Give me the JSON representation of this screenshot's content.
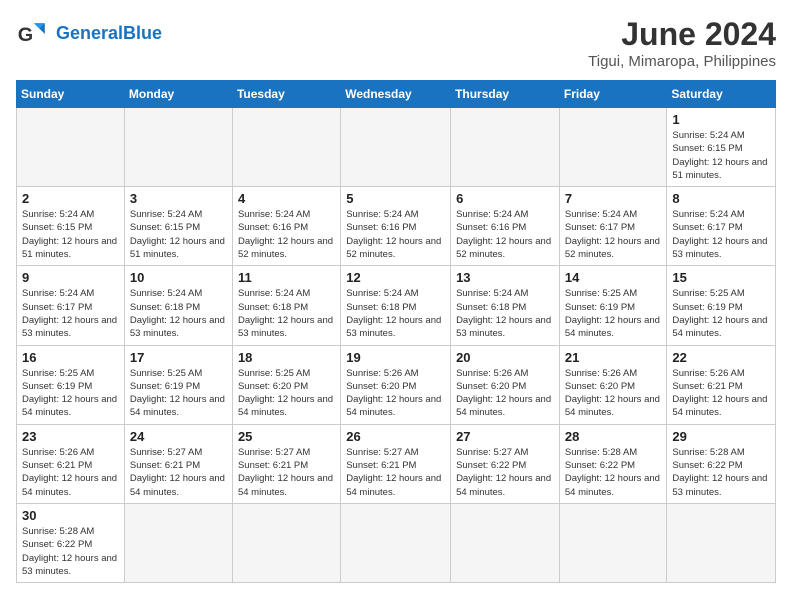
{
  "header": {
    "logo_general": "General",
    "logo_blue": "Blue",
    "month_title": "June 2024",
    "location": "Tigui, Mimaropa, Philippines"
  },
  "days_of_week": [
    "Sunday",
    "Monday",
    "Tuesday",
    "Wednesday",
    "Thursday",
    "Friday",
    "Saturday"
  ],
  "weeks": [
    [
      {
        "day": "",
        "info": ""
      },
      {
        "day": "",
        "info": ""
      },
      {
        "day": "",
        "info": ""
      },
      {
        "day": "",
        "info": ""
      },
      {
        "day": "",
        "info": ""
      },
      {
        "day": "",
        "info": ""
      },
      {
        "day": "1",
        "info": "Sunrise: 5:24 AM\nSunset: 6:15 PM\nDaylight: 12 hours and 51 minutes."
      }
    ],
    [
      {
        "day": "2",
        "info": "Sunrise: 5:24 AM\nSunset: 6:15 PM\nDaylight: 12 hours and 51 minutes."
      },
      {
        "day": "3",
        "info": "Sunrise: 5:24 AM\nSunset: 6:15 PM\nDaylight: 12 hours and 51 minutes."
      },
      {
        "day": "4",
        "info": "Sunrise: 5:24 AM\nSunset: 6:16 PM\nDaylight: 12 hours and 52 minutes."
      },
      {
        "day": "5",
        "info": "Sunrise: 5:24 AM\nSunset: 6:16 PM\nDaylight: 12 hours and 52 minutes."
      },
      {
        "day": "6",
        "info": "Sunrise: 5:24 AM\nSunset: 6:16 PM\nDaylight: 12 hours and 52 minutes."
      },
      {
        "day": "7",
        "info": "Sunrise: 5:24 AM\nSunset: 6:17 PM\nDaylight: 12 hours and 52 minutes."
      },
      {
        "day": "8",
        "info": "Sunrise: 5:24 AM\nSunset: 6:17 PM\nDaylight: 12 hours and 53 minutes."
      }
    ],
    [
      {
        "day": "9",
        "info": "Sunrise: 5:24 AM\nSunset: 6:17 PM\nDaylight: 12 hours and 53 minutes."
      },
      {
        "day": "10",
        "info": "Sunrise: 5:24 AM\nSunset: 6:18 PM\nDaylight: 12 hours and 53 minutes."
      },
      {
        "day": "11",
        "info": "Sunrise: 5:24 AM\nSunset: 6:18 PM\nDaylight: 12 hours and 53 minutes."
      },
      {
        "day": "12",
        "info": "Sunrise: 5:24 AM\nSunset: 6:18 PM\nDaylight: 12 hours and 53 minutes."
      },
      {
        "day": "13",
        "info": "Sunrise: 5:24 AM\nSunset: 6:18 PM\nDaylight: 12 hours and 53 minutes."
      },
      {
        "day": "14",
        "info": "Sunrise: 5:25 AM\nSunset: 6:19 PM\nDaylight: 12 hours and 54 minutes."
      },
      {
        "day": "15",
        "info": "Sunrise: 5:25 AM\nSunset: 6:19 PM\nDaylight: 12 hours and 54 minutes."
      }
    ],
    [
      {
        "day": "16",
        "info": "Sunrise: 5:25 AM\nSunset: 6:19 PM\nDaylight: 12 hours and 54 minutes."
      },
      {
        "day": "17",
        "info": "Sunrise: 5:25 AM\nSunset: 6:19 PM\nDaylight: 12 hours and 54 minutes."
      },
      {
        "day": "18",
        "info": "Sunrise: 5:25 AM\nSunset: 6:20 PM\nDaylight: 12 hours and 54 minutes."
      },
      {
        "day": "19",
        "info": "Sunrise: 5:26 AM\nSunset: 6:20 PM\nDaylight: 12 hours and 54 minutes."
      },
      {
        "day": "20",
        "info": "Sunrise: 5:26 AM\nSunset: 6:20 PM\nDaylight: 12 hours and 54 minutes."
      },
      {
        "day": "21",
        "info": "Sunrise: 5:26 AM\nSunset: 6:20 PM\nDaylight: 12 hours and 54 minutes."
      },
      {
        "day": "22",
        "info": "Sunrise: 5:26 AM\nSunset: 6:21 PM\nDaylight: 12 hours and 54 minutes."
      }
    ],
    [
      {
        "day": "23",
        "info": "Sunrise: 5:26 AM\nSunset: 6:21 PM\nDaylight: 12 hours and 54 minutes."
      },
      {
        "day": "24",
        "info": "Sunrise: 5:27 AM\nSunset: 6:21 PM\nDaylight: 12 hours and 54 minutes."
      },
      {
        "day": "25",
        "info": "Sunrise: 5:27 AM\nSunset: 6:21 PM\nDaylight: 12 hours and 54 minutes."
      },
      {
        "day": "26",
        "info": "Sunrise: 5:27 AM\nSunset: 6:21 PM\nDaylight: 12 hours and 54 minutes."
      },
      {
        "day": "27",
        "info": "Sunrise: 5:27 AM\nSunset: 6:22 PM\nDaylight: 12 hours and 54 minutes."
      },
      {
        "day": "28",
        "info": "Sunrise: 5:28 AM\nSunset: 6:22 PM\nDaylight: 12 hours and 54 minutes."
      },
      {
        "day": "29",
        "info": "Sunrise: 5:28 AM\nSunset: 6:22 PM\nDaylight: 12 hours and 53 minutes."
      }
    ],
    [
      {
        "day": "30",
        "info": "Sunrise: 5:28 AM\nSunset: 6:22 PM\nDaylight: 12 hours and 53 minutes."
      },
      {
        "day": "",
        "info": ""
      },
      {
        "day": "",
        "info": ""
      },
      {
        "day": "",
        "info": ""
      },
      {
        "day": "",
        "info": ""
      },
      {
        "day": "",
        "info": ""
      },
      {
        "day": "",
        "info": ""
      }
    ]
  ]
}
